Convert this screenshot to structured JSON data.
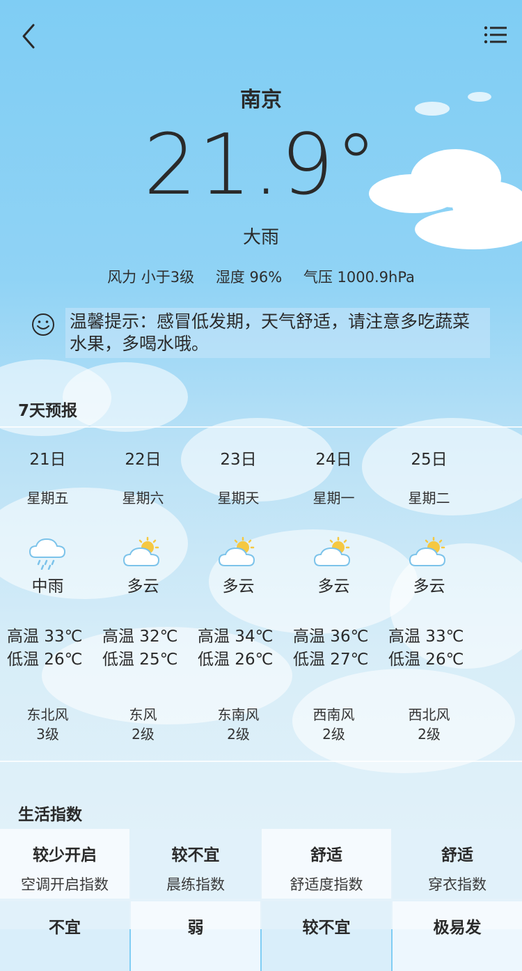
{
  "city": "南京",
  "temperature": "21.9°",
  "condition": "大雨",
  "meta": {
    "wind": "风力 小于3级",
    "humidity": "湿度 96%",
    "pressure": "气压 1000.9hPa"
  },
  "tip": "温馨提示：感冒低发期，天气舒适，请注意多吃蔬菜水果，多喝水哦。",
  "forecast_title": "7天预报",
  "forecast": [
    {
      "date": "21日",
      "week": "星期五",
      "icon": "rain-cloud-icon",
      "cond": "中雨",
      "high": "高温 33℃",
      "low": "低温 26℃",
      "wind_dir": "东北风",
      "wind_lv": "3级"
    },
    {
      "date": "22日",
      "week": "星期六",
      "icon": "partly-cloudy-icon",
      "cond": "多云",
      "high": "高温 32℃",
      "low": "低温 25℃",
      "wind_dir": "东风",
      "wind_lv": "2级"
    },
    {
      "date": "23日",
      "week": "星期天",
      "icon": "partly-cloudy-icon",
      "cond": "多云",
      "high": "高温 34℃",
      "low": "低温 26℃",
      "wind_dir": "东南风",
      "wind_lv": "2级"
    },
    {
      "date": "24日",
      "week": "星期一",
      "icon": "partly-cloudy-icon",
      "cond": "多云",
      "high": "高温 36℃",
      "low": "低温 27℃",
      "wind_dir": "西南风",
      "wind_lv": "2级"
    },
    {
      "date": "25日",
      "week": "星期二",
      "icon": "partly-cloudy-icon",
      "cond": "多云",
      "high": "高温 33℃",
      "low": "低温 26℃",
      "wind_dir": "西北风",
      "wind_lv": "2级"
    }
  ],
  "life_title": "生活指数",
  "life_index": [
    {
      "level": "较少开启",
      "name": "空调开启指数"
    },
    {
      "level": "较不宜",
      "name": "晨练指数"
    },
    {
      "level": "舒适",
      "name": "舒适度指数"
    },
    {
      "level": "舒适",
      "name": "穿衣指数"
    },
    {
      "level": "不宜",
      "name": ""
    },
    {
      "level": "弱",
      "name": ""
    },
    {
      "level": "较不宜",
      "name": ""
    },
    {
      "level": "极易发",
      "name": ""
    }
  ],
  "colors": {
    "sky_top": "#7fcdf4",
    "text": "#2a2a2a",
    "sun": "#f5c842",
    "cloud_icon": "#8fcdf0"
  }
}
